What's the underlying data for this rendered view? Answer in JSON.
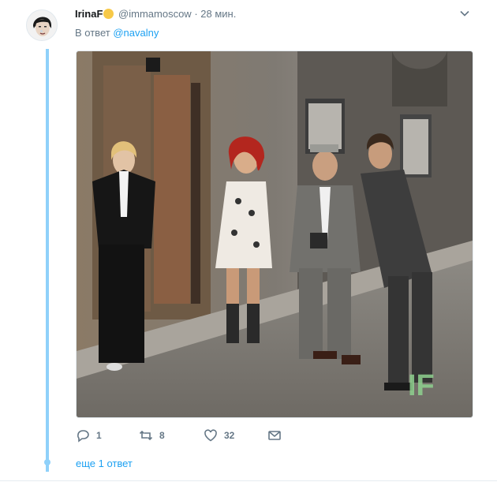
{
  "tweet": {
    "display_name": "IrinaF",
    "emoji": "thinking-face-emoji",
    "handle": "@immamoscow",
    "separator": "·",
    "time": "28 мин.",
    "reply_prefix": "В ответ",
    "reply_to": "@navalny",
    "image_watermark": "IF"
  },
  "actions": {
    "replies": "1",
    "retweets": "8",
    "likes": "32"
  },
  "thread": {
    "more_replies": "еще 1 ответ"
  },
  "icons": {
    "reply": "reply-icon",
    "retweet": "retweet-icon",
    "like": "heart-icon",
    "dm": "envelope-icon",
    "menu": "chevron-down-icon"
  },
  "colors": {
    "accent": "#1da1f2",
    "thread_line": "#8fd1fa",
    "muted": "#657786"
  }
}
